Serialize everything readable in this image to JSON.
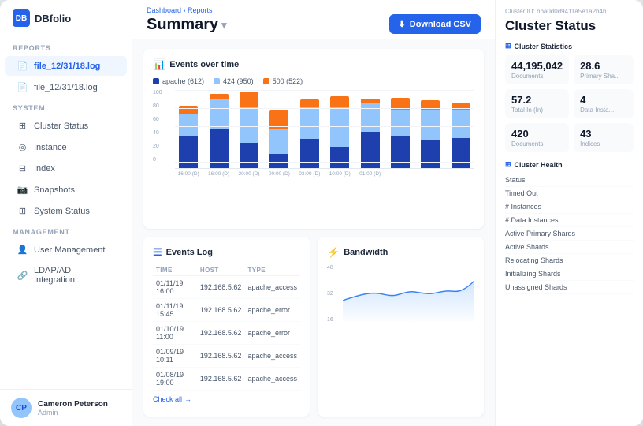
{
  "app": {
    "name": "DBfolio"
  },
  "sidebar": {
    "reports_label": "REPORTS",
    "reports_items": [
      {
        "icon": "📄",
        "label": "file_12/31/18.log",
        "active": true
      },
      {
        "icon": "📄",
        "label": "file_12/31/18.log",
        "active": false
      }
    ],
    "system_label": "SYSTEM",
    "system_items": [
      {
        "icon": "⊞",
        "label": "Cluster Status"
      },
      {
        "icon": "◎",
        "label": "Instance"
      },
      {
        "icon": "⊟",
        "label": "Index"
      },
      {
        "icon": "📷",
        "label": "Snapshots"
      },
      {
        "icon": "⊞",
        "label": "System Status"
      }
    ],
    "management_label": "MANAGEMENT",
    "management_items": [
      {
        "icon": "👤",
        "label": "User Management"
      },
      {
        "icon": "🔗",
        "label": "LDAP/AD Integration"
      }
    ],
    "user": {
      "name": "Cameron Peterson",
      "role": "Admin"
    }
  },
  "header": {
    "breadcrumb_dashboard": "Dashboard",
    "breadcrumb_sep": " > ",
    "breadcrumb_reports": "Reports",
    "title": "Summary",
    "download_btn": "Download CSV"
  },
  "events_chart": {
    "title": "Events over time",
    "legend": [
      {
        "color": "#1e40af",
        "label": "apache (612)"
      },
      {
        "color": "#93c5fd",
        "label": "424 (950)"
      },
      {
        "color": "#f97316",
        "label": "500 (522)"
      }
    ],
    "y_labels": [
      "100",
      "80",
      "60",
      "40",
      "20",
      "0"
    ],
    "x_labels": [
      "16:00 (D)",
      "16:00 (D)",
      "20:00 (D)",
      "00:00 (D)",
      "03:00 (D)",
      "10:00 (D)",
      "01:00 (D)"
    ],
    "bars": [
      {
        "dark": 45,
        "light": 30,
        "orange": 12
      },
      {
        "dark": 55,
        "light": 40,
        "orange": 8
      },
      {
        "dark": 35,
        "light": 50,
        "orange": 20
      },
      {
        "dark": 20,
        "light": 35,
        "orange": 25
      },
      {
        "dark": 40,
        "light": 45,
        "orange": 10
      },
      {
        "dark": 30,
        "light": 55,
        "orange": 15
      },
      {
        "dark": 50,
        "light": 40,
        "orange": 5
      },
      {
        "dark": 45,
        "light": 35,
        "orange": 18
      },
      {
        "dark": 38,
        "light": 42,
        "orange": 14
      },
      {
        "dark": 42,
        "light": 38,
        "orange": 10
      }
    ]
  },
  "events_log": {
    "title": "Events Log",
    "columns": [
      "TIME",
      "HOST",
      "TYPE"
    ],
    "rows": [
      {
        "time": "01/11/19 16:00",
        "host": "192.168.5.62",
        "type": "apache_access"
      },
      {
        "time": "01/11/19 15:45",
        "host": "192.168.5.62",
        "type": "apache_error"
      },
      {
        "time": "01/10/19 11:00",
        "host": "192.168.5.62",
        "type": "apache_error"
      },
      {
        "time": "01/09/19 10:11",
        "host": "192.168.5.62",
        "type": "apache_access"
      },
      {
        "time": "01/08/19 19:00",
        "host": "192.168.5.62",
        "type": "apache_access"
      }
    ],
    "check_all": "Check all"
  },
  "bandwidth": {
    "title": "Bandwidth",
    "y_labels": [
      "48",
      "32",
      "16"
    ]
  },
  "cluster_status": {
    "cluster_id": "Cluster ID: bba0d0d9411a5e1a2b4b",
    "title": "Cluster Status",
    "stats_title": "Cluster Statistics",
    "stats": [
      {
        "value": "44,195,042",
        "label": "Documents"
      },
      {
        "value": "28.6",
        "label": "Primary Sha..."
      },
      {
        "value": "57.2",
        "label": "Total In (In)"
      },
      {
        "value": "4",
        "label": "Data Insta..."
      },
      {
        "value": "420",
        "label": "Documents"
      },
      {
        "value": "43",
        "label": "Indices"
      }
    ],
    "health_title": "Cluster Health",
    "health_items": [
      "Status",
      "Timed Out",
      "# Instances",
      "# Data Instances",
      "Active Primary Shards",
      "Active Shards",
      "Relocating Shards",
      "Initializing Shards",
      "Unassigned Shards"
    ]
  }
}
